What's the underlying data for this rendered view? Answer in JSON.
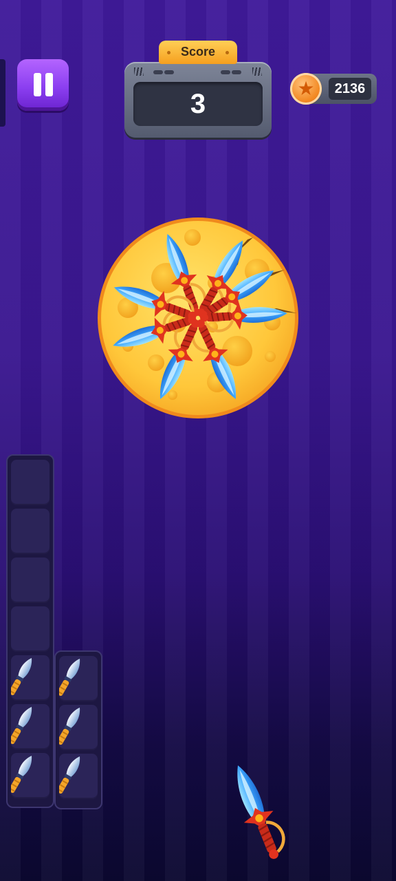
{
  "hud": {
    "score_label": "Score",
    "score_value": "3",
    "coins": "2136",
    "pause_icon": "pause-icon",
    "coin_icon": "star-coin-icon"
  },
  "target": {
    "name": "cheese-wheel",
    "stuck_knives": 10,
    "color": "#ffc93a"
  },
  "knife_racks": [
    {
      "slots": 7,
      "knives": 3
    },
    {
      "slots": 3,
      "knives": 3
    }
  ],
  "colors": {
    "background_top": "#3f1a9a",
    "background_bottom": "#0b0830",
    "pause_button": "#8b3ff0",
    "score_tab": "#ffcf56",
    "knife_blade": "#4fb4ff",
    "knife_hilt": "#e0331f"
  }
}
